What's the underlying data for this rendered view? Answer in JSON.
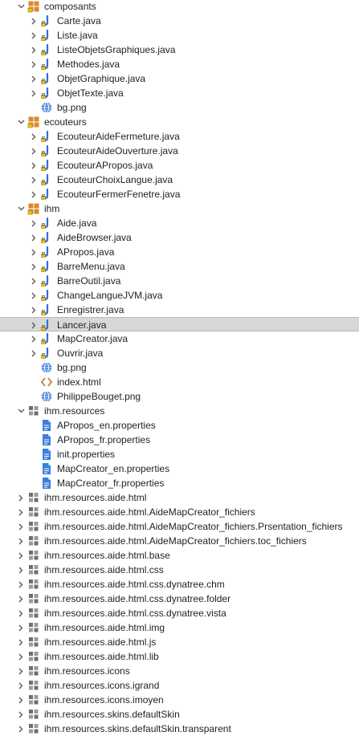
{
  "colors": {
    "selection_bg": "#d8d8d8",
    "java_blue": "#2f6fd6",
    "package_orange": "#d98b2e",
    "file_blue": "#3a7fe0",
    "html_orange": "#c77a2a",
    "pkg_gray": "#6e6e6e"
  },
  "tree": [
    {
      "label": "composants",
      "level": 0,
      "icon": "java-package-icon",
      "expanded": true
    },
    {
      "label": "Carte.java",
      "level": 1,
      "icon": "java-file-icon",
      "expanded": false
    },
    {
      "label": "Liste.java",
      "level": 1,
      "icon": "java-file-icon",
      "expanded": false
    },
    {
      "label": "ListeObjetsGraphiques.java",
      "level": 1,
      "icon": "java-file-icon",
      "expanded": false
    },
    {
      "label": "Methodes.java",
      "level": 1,
      "icon": "java-file-icon",
      "expanded": false
    },
    {
      "label": "ObjetGraphique.java",
      "level": 1,
      "icon": "java-file-icon",
      "expanded": false
    },
    {
      "label": "ObjetTexte.java",
      "level": 1,
      "icon": "java-file-icon",
      "expanded": false
    },
    {
      "label": "bg.png",
      "level": 1,
      "icon": "image-file-icon"
    },
    {
      "label": "ecouteurs",
      "level": 0,
      "icon": "java-package-icon",
      "expanded": true
    },
    {
      "label": "EcouteurAideFermeture.java",
      "level": 1,
      "icon": "java-file-icon",
      "expanded": false
    },
    {
      "label": "EcouteurAideOuverture.java",
      "level": 1,
      "icon": "java-file-icon",
      "expanded": false
    },
    {
      "label": "EcouteurAPropos.java",
      "level": 1,
      "icon": "java-file-icon",
      "expanded": false
    },
    {
      "label": "EcouteurChoixLangue.java",
      "level": 1,
      "icon": "java-file-icon",
      "expanded": false
    },
    {
      "label": "EcouteurFermerFenetre.java",
      "level": 1,
      "icon": "java-file-icon",
      "expanded": false
    },
    {
      "label": "ihm",
      "level": 0,
      "icon": "java-package-icon",
      "expanded": true
    },
    {
      "label": "Aide.java",
      "level": 1,
      "icon": "java-file-icon",
      "expanded": false
    },
    {
      "label": "AideBrowser.java",
      "level": 1,
      "icon": "java-file-icon",
      "expanded": false
    },
    {
      "label": "APropos.java",
      "level": 1,
      "icon": "java-file-icon",
      "expanded": false
    },
    {
      "label": "BarreMenu.java",
      "level": 1,
      "icon": "java-file-icon",
      "expanded": false
    },
    {
      "label": "BarreOutil.java",
      "level": 1,
      "icon": "java-file-icon",
      "expanded": false
    },
    {
      "label": "ChangeLangueJVM.java",
      "level": 1,
      "icon": "java-file-icon",
      "expanded": false
    },
    {
      "label": "Enregistrer.java",
      "level": 1,
      "icon": "java-file-icon",
      "expanded": false
    },
    {
      "label": "Lancer.java",
      "level": 1,
      "icon": "java-file-icon",
      "expanded": false,
      "selected": true
    },
    {
      "label": "MapCreator.java",
      "level": 1,
      "icon": "java-file-icon",
      "expanded": false
    },
    {
      "label": "Ouvrir.java",
      "level": 1,
      "icon": "java-file-icon",
      "expanded": false
    },
    {
      "label": "bg.png",
      "level": 1,
      "icon": "image-file-icon"
    },
    {
      "label": "index.html",
      "level": 1,
      "icon": "html-file-icon"
    },
    {
      "label": "PhilippeBouget.png",
      "level": 1,
      "icon": "image-file-icon"
    },
    {
      "label": "ihm.resources",
      "level": 0,
      "icon": "resource-package-icon",
      "expanded": true
    },
    {
      "label": "APropos_en.properties",
      "level": 1,
      "icon": "properties-file-icon"
    },
    {
      "label": "APropos_fr.properties",
      "level": 1,
      "icon": "properties-file-icon"
    },
    {
      "label": "init.properties",
      "level": 1,
      "icon": "properties-file-icon"
    },
    {
      "label": "MapCreator_en.properties",
      "level": 1,
      "icon": "properties-file-icon"
    },
    {
      "label": "MapCreator_fr.properties",
      "level": 1,
      "icon": "properties-file-icon"
    },
    {
      "label": "ihm.resources.aide.html",
      "level": 0,
      "icon": "resource-package-icon",
      "expanded": false
    },
    {
      "label": "ihm.resources.aide.html.AideMapCreator_fichiers",
      "level": 0,
      "icon": "resource-package-icon",
      "expanded": false
    },
    {
      "label": "ihm.resources.aide.html.AideMapCreator_fichiers.Prsentation_fichiers",
      "level": 0,
      "icon": "resource-package-icon",
      "expanded": false
    },
    {
      "label": "ihm.resources.aide.html.AideMapCreator_fichiers.toc_fichiers",
      "level": 0,
      "icon": "resource-package-icon",
      "expanded": false
    },
    {
      "label": "ihm.resources.aide.html.base",
      "level": 0,
      "icon": "resource-package-icon",
      "expanded": false
    },
    {
      "label": "ihm.resources.aide.html.css",
      "level": 0,
      "icon": "resource-package-icon",
      "expanded": false
    },
    {
      "label": "ihm.resources.aide.html.css.dynatree.chm",
      "level": 0,
      "icon": "resource-package-icon",
      "expanded": false
    },
    {
      "label": "ihm.resources.aide.html.css.dynatree.folder",
      "level": 0,
      "icon": "resource-package-icon",
      "expanded": false
    },
    {
      "label": "ihm.resources.aide.html.css.dynatree.vista",
      "level": 0,
      "icon": "resource-package-icon",
      "expanded": false
    },
    {
      "label": "ihm.resources.aide.html.img",
      "level": 0,
      "icon": "resource-package-icon",
      "expanded": false
    },
    {
      "label": "ihm.resources.aide.html.js",
      "level": 0,
      "icon": "resource-package-icon",
      "expanded": false
    },
    {
      "label": "ihm.resources.aide.html.lib",
      "level": 0,
      "icon": "resource-package-icon",
      "expanded": false
    },
    {
      "label": "ihm.resources.icons",
      "level": 0,
      "icon": "resource-package-icon",
      "expanded": false
    },
    {
      "label": "ihm.resources.icons.igrand",
      "level": 0,
      "icon": "resource-package-icon",
      "expanded": false
    },
    {
      "label": "ihm.resources.icons.imoyen",
      "level": 0,
      "icon": "resource-package-icon",
      "expanded": false
    },
    {
      "label": "ihm.resources.skins.defaultSkin",
      "level": 0,
      "icon": "resource-package-icon",
      "expanded": false
    },
    {
      "label": "ihm.resources.skins.defaultSkin.transparent",
      "level": 0,
      "icon": "resource-package-icon",
      "expanded": false
    }
  ]
}
